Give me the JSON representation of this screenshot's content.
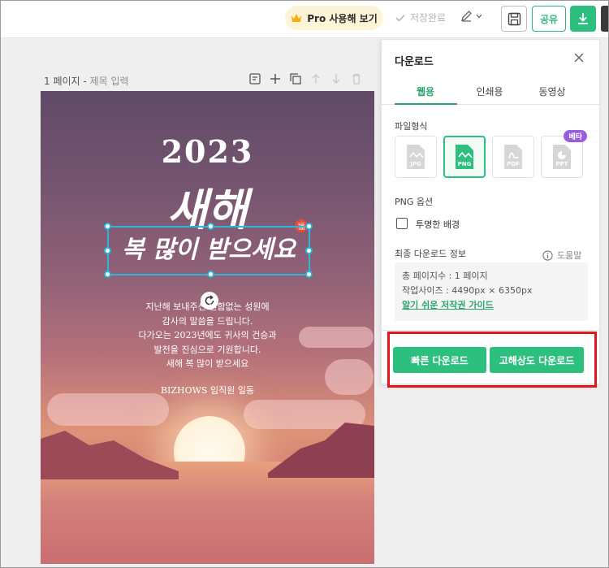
{
  "topbar": {
    "pro_label": "Pro 사용해 보기",
    "saved_label": "저장완료",
    "share_label": "공유"
  },
  "editor": {
    "page_number": "1 페이지",
    "page_title_placeholder": "제목 입력"
  },
  "poster": {
    "year": "2023",
    "headline": "새해",
    "slogan": "복 많이 받으세요",
    "stamp": "福",
    "message_lines": [
      "지난해 보내주신 변함없는 성원에",
      "감사의 말씀을 드립니다.",
      "다가오는 2023년에도 귀사의 건승과",
      "발전을 진심으로 기원합니다.",
      "새해 복 많이 받으세요"
    ],
    "signature": "BIZHOWS 임직원 일동"
  },
  "download_panel": {
    "title": "다운로드",
    "tabs": [
      "웹용",
      "인쇄용",
      "동영상"
    ],
    "file_format_label": "파일형식",
    "formats": [
      {
        "label": "JPG",
        "active": false
      },
      {
        "label": "PNG",
        "active": true
      },
      {
        "label": "PDF",
        "active": false
      },
      {
        "label": "PPT",
        "active": false,
        "badge": "베타"
      }
    ],
    "png_options_label": "PNG 옵션",
    "transparent_label": "투명한 배경",
    "final_info_label": "최종 다운로드 정보",
    "help_label": "도움말",
    "page_count": "총 페이지수 : 1 페이지",
    "work_size": "작업사이즈 : 4490px × 6350px",
    "copyright_link": "알기 쉬운 저작권 가이드",
    "quick_download": "빠른 다운로드",
    "hd_download": "고해상도 다운로드"
  },
  "colors": {
    "accent_green": "#2cbf7e",
    "highlight_red": "#e3141b",
    "beta_purple": "#9a5de0"
  }
}
